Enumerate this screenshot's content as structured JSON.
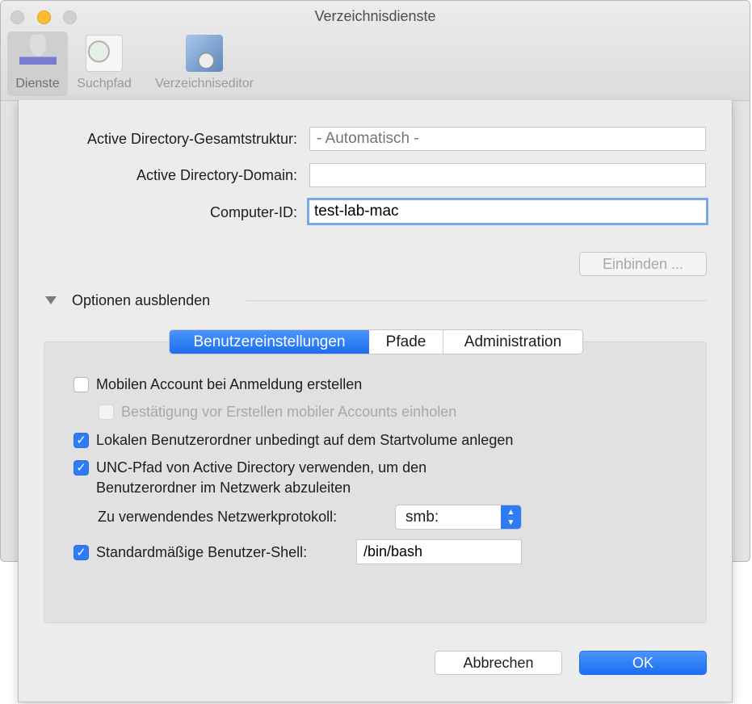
{
  "window": {
    "title": "Verzeichnisdienste"
  },
  "toolbar": [
    {
      "label": "Dienste",
      "icon": "services-icon",
      "selected": true
    },
    {
      "label": "Suchpfad",
      "icon": "search-path-icon"
    },
    {
      "label": "Verzeichniseditor",
      "icon": "directory-editor-icon"
    }
  ],
  "form": {
    "forest_label": "Active Directory-Gesamtstruktur:",
    "forest_placeholder": "- Automatisch -",
    "forest_value": "",
    "domain_label": "Active Directory-Domain:",
    "domain_value": "",
    "computer_id_label": "Computer-ID:",
    "computer_id_value": "test-lab-mac",
    "bind_button": "Einbinden ..."
  },
  "options_toggle": "Optionen ausblenden",
  "tabs": [
    {
      "label": "Benutzereinstellungen",
      "selected": true
    },
    {
      "label": "Pfade"
    },
    {
      "label": "Administration"
    }
  ],
  "settings": {
    "mobile_account": {
      "label": "Mobilen Account bei Anmeldung erstellen",
      "checked": false
    },
    "confirm_mobile": {
      "label": "Bestätigung vor Erstellen mobiler Accounts einholen",
      "checked": false,
      "disabled": true
    },
    "local_home": {
      "label": "Lokalen Benutzerordner unbedingt auf dem Startvolume anlegen",
      "checked": true
    },
    "unc_path": {
      "label1": "UNC-Pfad von Active Directory verwenden, um den",
      "label2": "Benutzerordner im Netzwerk abzuleiten",
      "checked": true
    },
    "protocol_label": "Zu verwendendes Netzwerkprotokoll:",
    "protocol_value": "smb:",
    "shell": {
      "label": "Standardmäßige Benutzer-Shell:",
      "checked": true,
      "value": "/bin/bash"
    }
  },
  "buttons": {
    "cancel": "Abbrechen",
    "ok": "OK"
  },
  "colors": {
    "accent": "#2f7bf5",
    "minimize": "#febc2e"
  }
}
